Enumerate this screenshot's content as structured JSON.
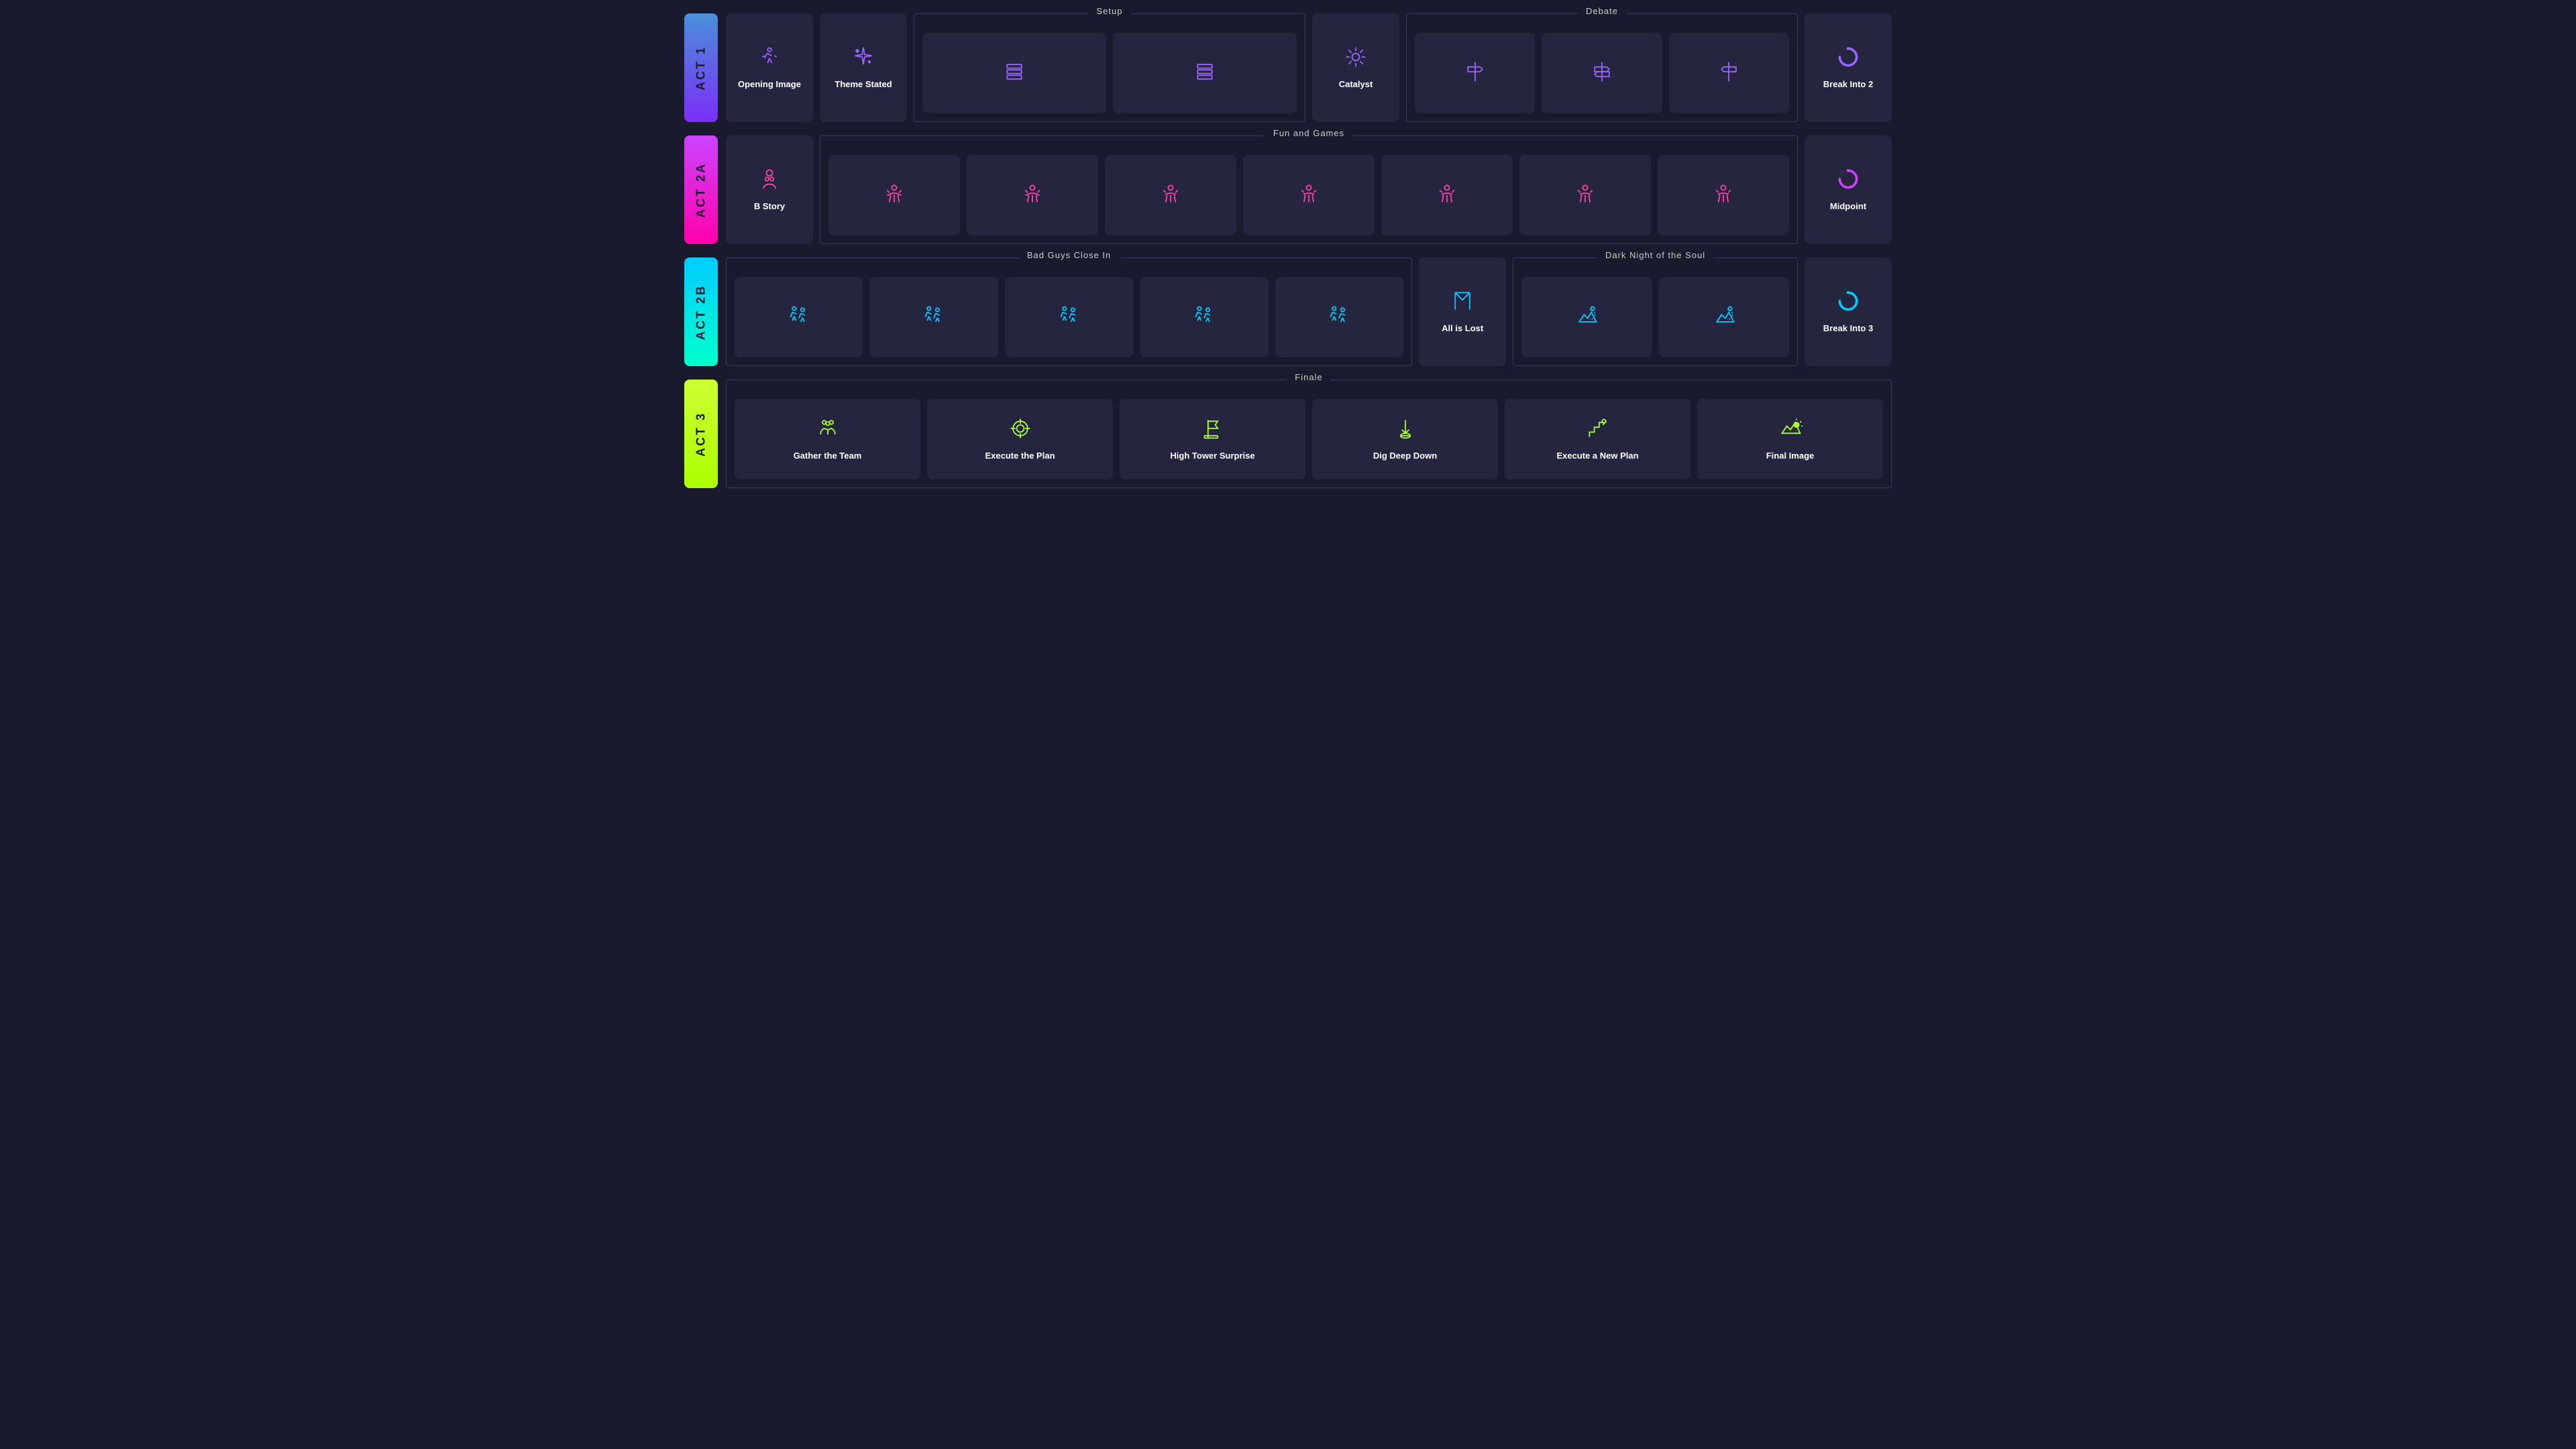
{
  "acts": [
    {
      "id": "act1",
      "label": "ACT 1",
      "class": "act1",
      "sections": [
        {
          "id": "setup",
          "label": "Setup",
          "cards": [
            {
              "id": "opening-image",
              "label": "Opening Image",
              "icon": "running",
              "iconColor": "purple"
            },
            {
              "id": "theme-stated",
              "label": "Theme Stated",
              "icon": "sparkle",
              "iconColor": "purple"
            },
            {
              "id": "setup-blank-1",
              "label": "",
              "icon": "stack",
              "iconColor": "purple"
            },
            {
              "id": "setup-blank-2",
              "label": "",
              "icon": "stack2",
              "iconColor": "purple"
            }
          ]
        },
        {
          "id": "catalyst",
          "label": null,
          "cards": [
            {
              "id": "catalyst",
              "label": "Catalyst",
              "icon": "starburst",
              "iconColor": "purple"
            }
          ]
        },
        {
          "id": "debate",
          "label": "Debate",
          "cards": [
            {
              "id": "debate-1",
              "label": "",
              "icon": "signpost",
              "iconColor": "purple"
            },
            {
              "id": "debate-2",
              "label": "",
              "icon": "signpost",
              "iconColor": "purple"
            },
            {
              "id": "debate-3",
              "label": "",
              "icon": "signpost",
              "iconColor": "purple"
            }
          ]
        },
        {
          "id": "break-into-2",
          "label": null,
          "cards": [
            {
              "id": "break-into-2",
              "label": "Break Into 2",
              "icon": "spinner-purple",
              "iconColor": "purple"
            }
          ]
        }
      ]
    },
    {
      "id": "act2a",
      "label": "ACT 2A",
      "class": "act2a",
      "sections": [
        {
          "id": "b-story",
          "label": null,
          "cards": [
            {
              "id": "b-story",
              "label": "B Story",
              "icon": "person",
              "iconColor": "pink"
            }
          ]
        },
        {
          "id": "fun-and-games",
          "label": "Fun and Games",
          "cards": [
            {
              "id": "fag-1",
              "label": "",
              "icon": "celebration",
              "iconColor": "pink"
            },
            {
              "id": "fag-2",
              "label": "",
              "icon": "celebration",
              "iconColor": "pink"
            },
            {
              "id": "fag-3",
              "label": "",
              "icon": "celebration",
              "iconColor": "pink"
            },
            {
              "id": "fag-4",
              "label": "",
              "icon": "celebration",
              "iconColor": "pink"
            },
            {
              "id": "fag-5",
              "label": "",
              "icon": "celebration",
              "iconColor": "pink"
            },
            {
              "id": "fag-6",
              "label": "",
              "icon": "celebration",
              "iconColor": "pink"
            },
            {
              "id": "fag-7",
              "label": "",
              "icon": "celebration",
              "iconColor": "pink"
            }
          ]
        },
        {
          "id": "midpoint",
          "label": null,
          "cards": [
            {
              "id": "midpoint",
              "label": "Midpoint",
              "icon": "spinner-pink",
              "iconColor": "pink"
            }
          ]
        }
      ]
    },
    {
      "id": "act2b",
      "label": "ACT 2B",
      "class": "act2b",
      "sections": [
        {
          "id": "bad-guys-close-in",
          "label": "Bad Guys Close In",
          "cards": [
            {
              "id": "bgci-1",
              "label": "",
              "icon": "runners",
              "iconColor": "cyan"
            },
            {
              "id": "bgci-2",
              "label": "",
              "icon": "runners",
              "iconColor": "cyan"
            },
            {
              "id": "bgci-3",
              "label": "",
              "icon": "runners",
              "iconColor": "cyan"
            },
            {
              "id": "bgci-4",
              "label": "",
              "icon": "runners",
              "iconColor": "cyan"
            },
            {
              "id": "bgci-5",
              "label": "",
              "icon": "runners",
              "iconColor": "cyan"
            }
          ]
        },
        {
          "id": "all-is-lost",
          "label": null,
          "cards": [
            {
              "id": "all-is-lost",
              "label": "All is Lost",
              "icon": "curtain",
              "iconColor": "cyan"
            }
          ]
        },
        {
          "id": "dark-night",
          "label": "Dark Night of the Soul",
          "cards": [
            {
              "id": "dnis-1",
              "label": "",
              "icon": "moon-mountain",
              "iconColor": "cyan"
            },
            {
              "id": "dnis-2",
              "label": "",
              "icon": "moon-mountain",
              "iconColor": "cyan"
            }
          ]
        },
        {
          "id": "break-into-3",
          "label": null,
          "cards": [
            {
              "id": "break-into-3",
              "label": "Break Into 3",
              "icon": "spinner-cyan",
              "iconColor": "cyan"
            }
          ]
        }
      ]
    },
    {
      "id": "act3",
      "label": "ACT 3",
      "class": "act3",
      "sections": [
        {
          "id": "finale",
          "label": "Finale",
          "cards": [
            {
              "id": "gather-team",
              "label": "Gather the Team",
              "icon": "team",
              "iconColor": "yellow-green"
            },
            {
              "id": "execute-plan",
              "label": "Execute the Plan",
              "icon": "target",
              "iconColor": "yellow-green"
            },
            {
              "id": "high-tower",
              "label": "High Tower Surprise",
              "icon": "flag",
              "iconColor": "yellow-green"
            },
            {
              "id": "dig-deep",
              "label": "Dig Deep Down",
              "icon": "shovel",
              "iconColor": "yellow-green"
            },
            {
              "id": "execute-new-plan",
              "label": "Execute a New Plan",
              "icon": "stairs",
              "iconColor": "yellow-green"
            },
            {
              "id": "final-image",
              "label": "Final Image",
              "icon": "sunrise",
              "iconColor": "yellow-green"
            }
          ]
        }
      ]
    }
  ]
}
